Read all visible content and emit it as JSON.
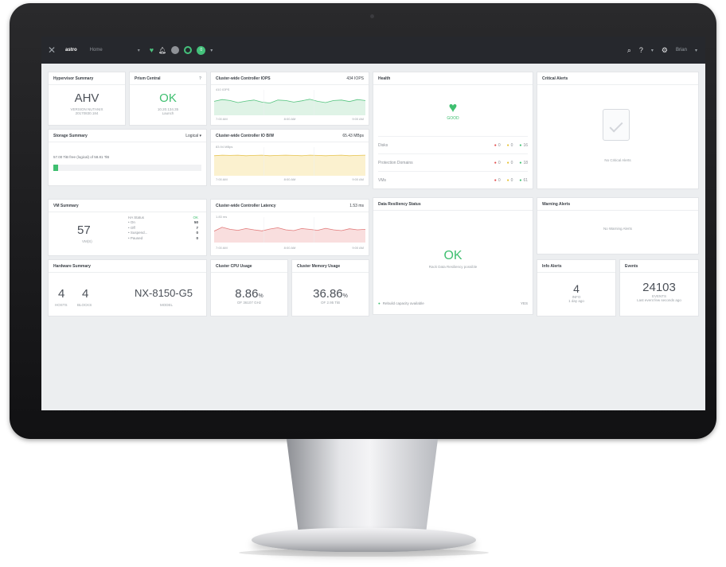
{
  "topbar": {
    "cluster_name": "astro",
    "breadcrumb": "Home",
    "alert_count": "0",
    "user": "Brian",
    "icons": [
      "close-x-icon",
      "heart-icon",
      "bell-icon",
      "search-icon",
      "help-icon",
      "gear-icon"
    ]
  },
  "hypervisor": {
    "title": "Hypervisor Summary",
    "name": "AHV",
    "version_label": "VERSION NUTANIX",
    "version": "20170830.184"
  },
  "prism_central": {
    "title": "Prism Central",
    "status": "OK",
    "ip": "10.20.134.35",
    "action": "Launch"
  },
  "iops": {
    "title": "Cluster-wide Controller IOPS",
    "value": "434 IOPS",
    "scale": "410 IOPS",
    "ticks": [
      "7:00 AM",
      "8:00 AM",
      "9:00 AM"
    ],
    "series": [
      0.55,
      0.62,
      0.58,
      0.5,
      0.56,
      0.6,
      0.52,
      0.48,
      0.6,
      0.58,
      0.52,
      0.57,
      0.63,
      0.55,
      0.5,
      0.58,
      0.6,
      0.54,
      0.62,
      0.58
    ]
  },
  "iobw": {
    "title": "Cluster-wide Controller IO B/W",
    "value": "65.43 MBps",
    "scale": "83.94 MBps",
    "ticks": [
      "7:00 AM",
      "8:00 AM",
      "9:00 AM"
    ],
    "series": [
      0.7,
      0.72,
      0.71,
      0.72,
      0.7,
      0.71,
      0.72,
      0.7,
      0.71,
      0.72,
      0.71,
      0.7,
      0.72,
      0.71,
      0.7,
      0.71,
      0.72,
      0.7,
      0.71,
      0.72
    ]
  },
  "latency": {
    "title": "Cluster-wide Controller Latency",
    "value": "1.53 ms",
    "scale": "1.83 ms",
    "ticks": [
      "7:00 AM",
      "8:00 AM",
      "9:00 AM"
    ],
    "series": [
      0.45,
      0.6,
      0.52,
      0.48,
      0.55,
      0.5,
      0.46,
      0.53,
      0.58,
      0.5,
      0.47,
      0.55,
      0.52,
      0.48,
      0.56,
      0.5,
      0.47,
      0.54,
      0.5,
      0.52
    ]
  },
  "health": {
    "title": "Health",
    "status": "GOOD",
    "rows": [
      {
        "label": "Disks",
        "red": "0",
        "yellow": "0",
        "green": "16"
      },
      {
        "label": "Protection Domains",
        "red": "0",
        "yellow": "0",
        "green": "18"
      },
      {
        "label": "VMs",
        "red": "0",
        "yellow": "0",
        "green": "61"
      }
    ]
  },
  "critical_alerts": {
    "title": "Critical Alerts",
    "empty": "No Critical Alerts"
  },
  "storage": {
    "title": "Storage Summary",
    "mode": "Logical",
    "usage_text": "57.00 TiB free (logical) of 58.81 TiB",
    "used_fraction": 0.031
  },
  "vm_summary": {
    "title": "VM Summary",
    "count": "57",
    "count_label": "VM(S)",
    "ha_label": "HA Status",
    "ha_value": "OK",
    "states": [
      {
        "label": "On",
        "value": "50"
      },
      {
        "label": "Off",
        "value": "7"
      },
      {
        "label": "Suspend...",
        "value": "0"
      },
      {
        "label": "Paused",
        "value": "0"
      }
    ]
  },
  "data_resiliency": {
    "title": "Data Resiliency Status",
    "status": "OK",
    "message": "Rack Data Resiliency possible",
    "footer": "Rebuild capacity available",
    "footer_value": "YES"
  },
  "warning_alerts": {
    "title": "Warning Alerts",
    "empty": "No Warning Alerts"
  },
  "hardware": {
    "title": "Hardware Summary",
    "hosts": "4",
    "hosts_label": "HOSTS",
    "blocks": "4",
    "blocks_label": "BLOCKS",
    "model": "NX-8150-G5",
    "model_label": "MODEL"
  },
  "cpu": {
    "title": "Cluster CPU Usage",
    "value": "8.86",
    "unit": "%",
    "sub": "OF 36107 GHz"
  },
  "memory": {
    "title": "Cluster Memory Usage",
    "value": "36.86",
    "unit": "%",
    "sub": "OF 2.95 TiB"
  },
  "info_alerts": {
    "title": "Info Alerts",
    "count": "4",
    "label": "INFO",
    "when": "1 day ago"
  },
  "events": {
    "title": "Events",
    "count": "24103",
    "label": "EVENTS",
    "when": "Last event few seconds ago"
  },
  "colors": {
    "iops_fill": "#dff3e6",
    "iops_line": "#55c47f",
    "iobw_fill": "#fbf1cf",
    "iobw_line": "#e6c451",
    "lat_fill": "#f9dede",
    "lat_line": "#e27a7a",
    "ok_green": "#3fbf70"
  }
}
